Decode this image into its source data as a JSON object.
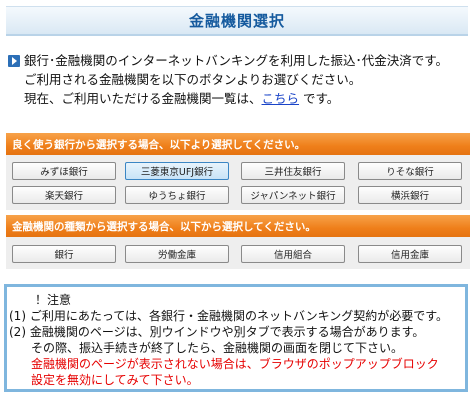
{
  "header": {
    "title": "金融機関選択"
  },
  "intro": {
    "line1": "銀行･金融機関のインターネットバンキングを利用した振込･代金決済です。",
    "line2": "ご利用される金融機関を以下のボタンよりお選びください。",
    "line3_prefix": "現在、ご利用いただける金融機関一覧は、",
    "line3_link": "こちら",
    "line3_suffix": " です。"
  },
  "frequent_section": {
    "title": "良く使う銀行から選択する場合、以下より選択してください。",
    "buttons": [
      {
        "label": "みずほ銀行"
      },
      {
        "label": "三菱東京UFJ銀行"
      },
      {
        "label": "三井住友銀行"
      },
      {
        "label": "りそな銀行"
      },
      {
        "label": "楽天銀行"
      },
      {
        "label": "ゆうちょ銀行"
      },
      {
        "label": "ジャパンネット銀行"
      },
      {
        "label": "横浜銀行"
      }
    ]
  },
  "type_section": {
    "title": "金融機関の種類から選択する場合、以下から選択してください。",
    "buttons": [
      {
        "label": "銀行"
      },
      {
        "label": "労働金庫"
      },
      {
        "label": "信用組合"
      },
      {
        "label": "信用金庫"
      }
    ]
  },
  "notice": {
    "heading": "！注意",
    "item1": "(1) ご利用にあたっては、各銀行・金融機関のネットバンキング契約が必要です。",
    "item2": "(2) 金融機関のページは、別ウインドウや別タブで表示する場合があります。",
    "item2_cont": "その際、振込手続きが終了したら、金融機関の画面を閉じて下さい。",
    "warn1": "金融機関のページが表示されない場合は、ブラウザのポップアップブロック",
    "warn2": "設定を無効にしてみて下さい。"
  },
  "colors": {
    "title_blue": "#155a9e",
    "section_orange": "#ef7f1a",
    "link_blue": "#1a44c8",
    "warning_red": "#e60000",
    "notice_border": "#7fb6de"
  }
}
